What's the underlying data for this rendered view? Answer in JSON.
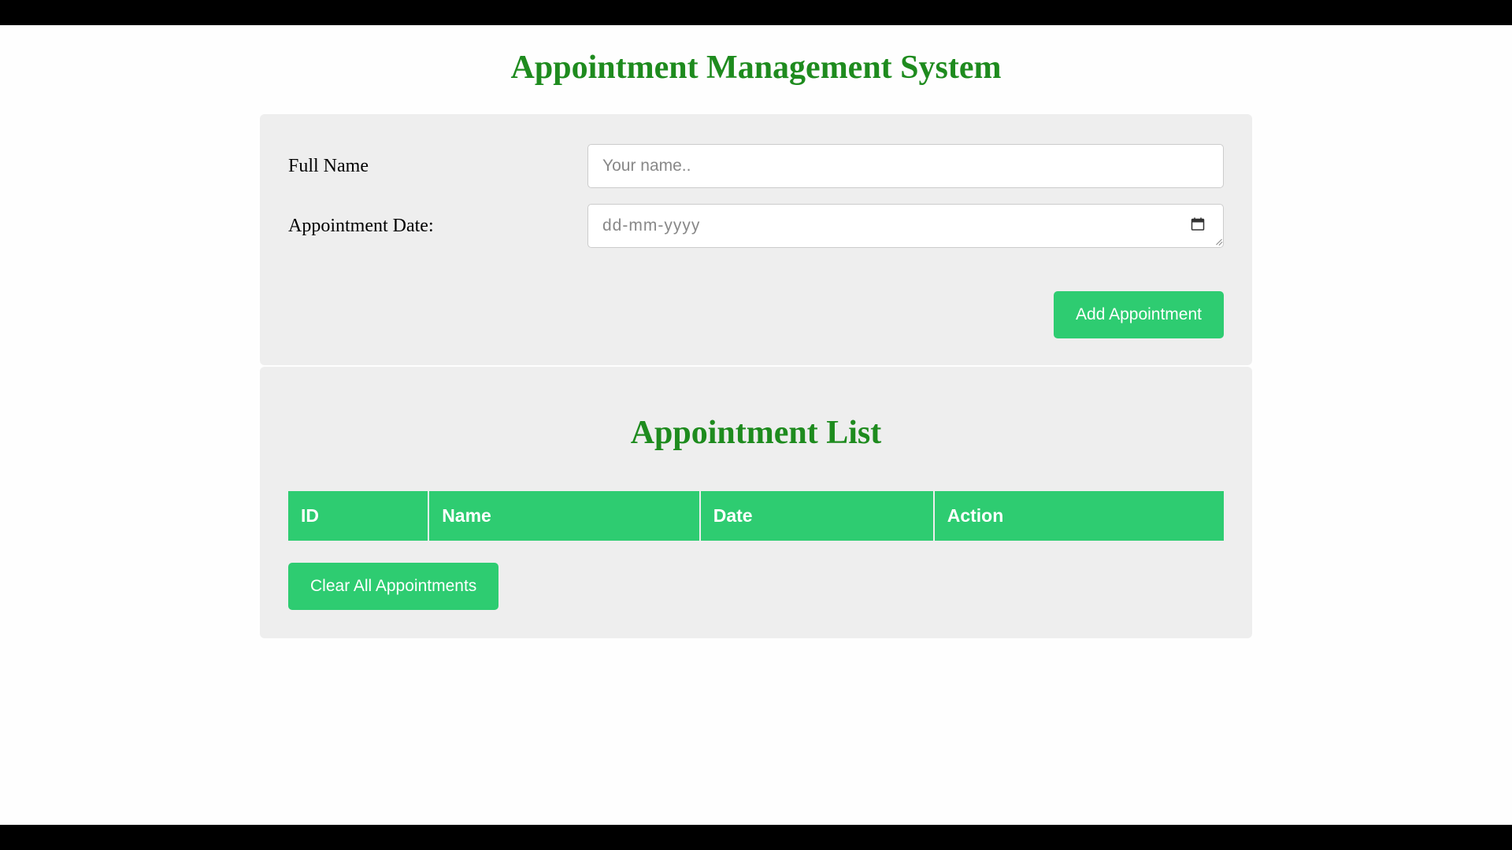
{
  "header": {
    "title": "Appointment Management System"
  },
  "form": {
    "fullNameLabel": "Full Name",
    "fullNamePlaceholder": "Your name..",
    "fullNameValue": "",
    "dateLabel": "Appointment Date:",
    "datePlaceholder": "dd-mm-yyyy",
    "dateValue": "",
    "addButtonLabel": "Add Appointment"
  },
  "list": {
    "title": "Appointment List",
    "columns": {
      "id": "ID",
      "name": "Name",
      "date": "Date",
      "action": "Action"
    },
    "rows": [],
    "clearButtonLabel": "Clear All Appointments"
  }
}
